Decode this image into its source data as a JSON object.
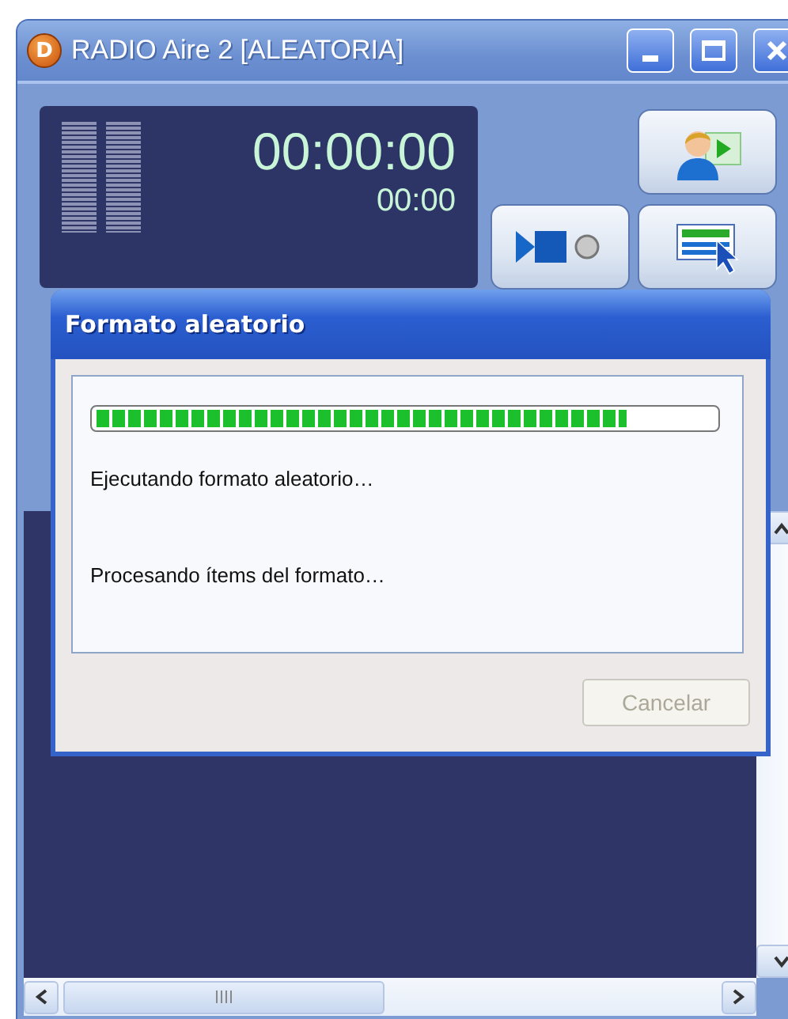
{
  "window": {
    "icon_letter": "D",
    "title": "RADIO Aire 2 [ALEATORIA]"
  },
  "display": {
    "elapsed": "00:00:00",
    "remaining": "00:00"
  },
  "dialog": {
    "title": "Formato aleatorio",
    "progress": {
      "level": 0.86
    },
    "messages": [
      "Ejecutando formato aleatorio…",
      "Procesando ítems del formato…"
    ],
    "buttons": [
      {
        "label": "Cancelar",
        "disabled": true
      }
    ]
  }
}
